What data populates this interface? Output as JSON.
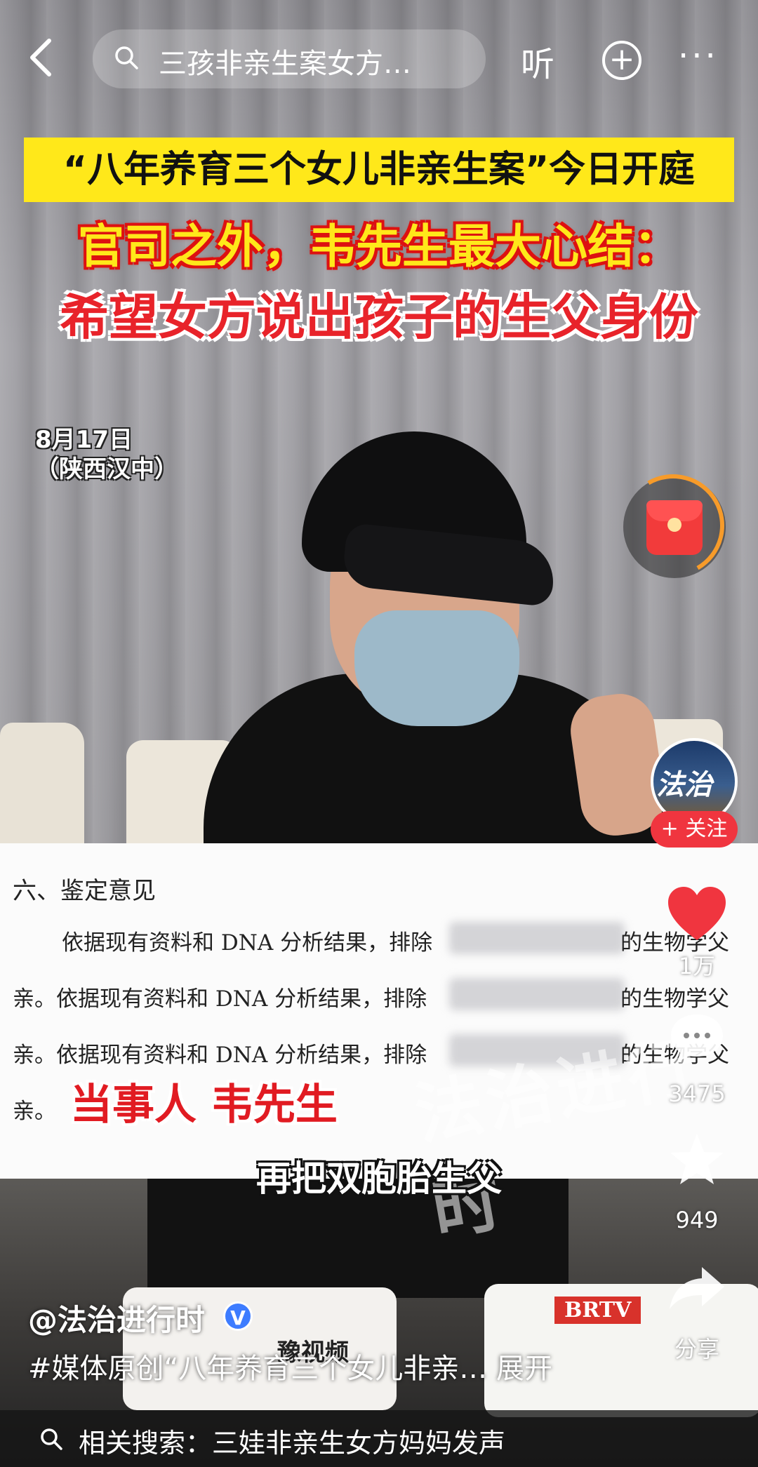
{
  "header": {
    "search_query": "三孩非亲生案女方…",
    "listen_label": "听"
  },
  "video": {
    "banner_title": "“八年养育三个女儿非亲生案”今日开庭",
    "caption_line1": "官司之外，韦先生最大心结：",
    "caption_line2": "希望女方说出孩子的生父身份",
    "date_line1": "8月17日",
    "date_line2": "（陕西汉中）",
    "speaker_tag": "当事人 韦先生",
    "subtitle": "再把双胞胎生父",
    "watermark": "法治进行时",
    "channel_left": "豫视频",
    "channel_right": "BRTV"
  },
  "document": {
    "heading": "六、鉴定意见",
    "line1_prefix": "依据现有资料和 DNA 分析结果，排除",
    "line1_suffix": "的生物学父",
    "line2_prefix": "亲。依据现有资料和 DNA 分析结果，排除",
    "line2_suffix": "的生物学父",
    "line3_prefix": "亲。依据现有资料和 DNA 分析结果，排除",
    "line3_suffix": "的生物学父",
    "line4": "亲。"
  },
  "rail": {
    "avatar_text": "法治",
    "follow_label": "+ 关注",
    "likes": "1万",
    "comments": "3475",
    "favorites": "949",
    "share_label": "分享"
  },
  "post": {
    "author": "@法治进行时",
    "verified_mark": "V",
    "description": "#媒体原创“八年养育三个女儿非亲… 展开"
  },
  "related": {
    "text": "相关搜索：三娃非亲生女方妈妈发声"
  },
  "colors": {
    "banner_yellow": "#ffe81a",
    "accent_red": "#f0353f",
    "verified_blue": "#3d7cff"
  }
}
